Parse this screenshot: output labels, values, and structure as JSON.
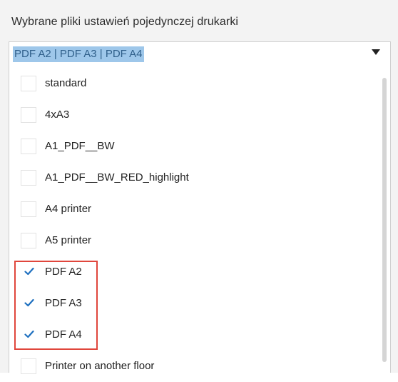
{
  "header": {
    "label": "Wybrane pliki ustawień pojedynczej drukarki"
  },
  "dropdown": {
    "selected_text": "PDF A2 | PDF A3 | PDF A4",
    "items": [
      {
        "label": "standard",
        "checked": false
      },
      {
        "label": "4xA3",
        "checked": false
      },
      {
        "label": "A1_PDF__BW",
        "checked": false
      },
      {
        "label": "A1_PDF__BW_RED_highlight",
        "checked": false
      },
      {
        "label": "A4 printer",
        "checked": false
      },
      {
        "label": "A5 printer",
        "checked": false
      },
      {
        "label": "PDF A2",
        "checked": true
      },
      {
        "label": "PDF A3",
        "checked": true
      },
      {
        "label": "PDF A4",
        "checked": true
      },
      {
        "label": "Printer on another floor",
        "checked": false
      }
    ]
  },
  "colors": {
    "selection_highlight": "#9ec7ea",
    "check_color": "#1d6fbf",
    "annotation_border": "#e0463c"
  }
}
